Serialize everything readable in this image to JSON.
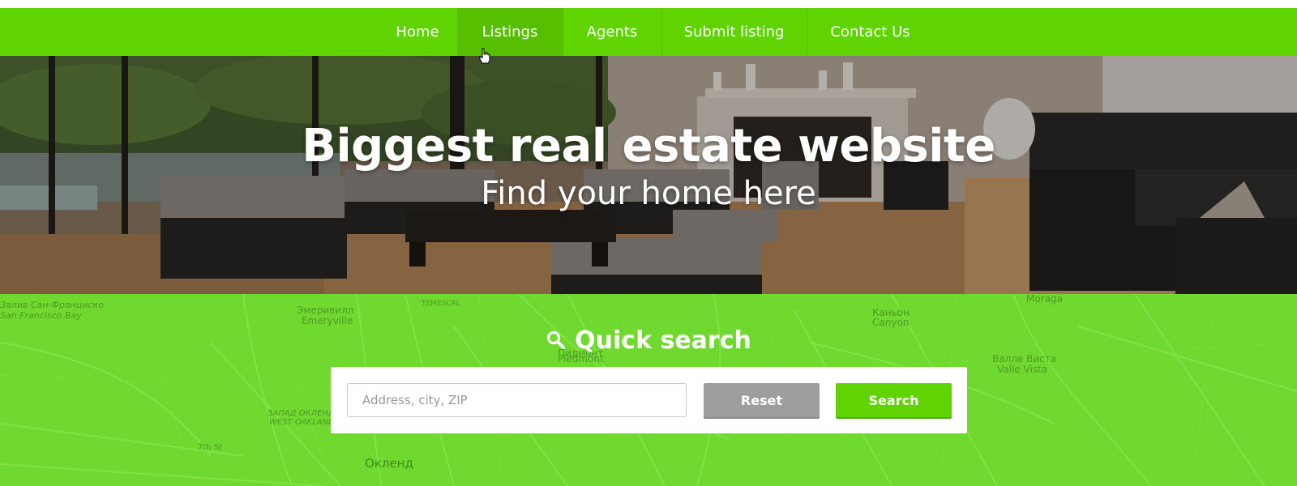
{
  "nav": {
    "items": [
      {
        "label": "Home"
      },
      {
        "label": "Listings"
      },
      {
        "label": "Agents"
      },
      {
        "label": "Submit listing"
      },
      {
        "label": "Contact Us"
      }
    ],
    "active_index": 1
  },
  "hero": {
    "title": "Biggest real estate website",
    "subtitle": "Find your home here"
  },
  "quick_search": {
    "title": "Quick search",
    "input_placeholder": "Address, city, ZIP",
    "reset_label": "Reset",
    "search_label": "Search"
  },
  "map_labels": {
    "sf_bay_ru": "Залив Сан-Франциско",
    "sf_bay_en": "San Francisco Bay",
    "emeryville_ru": "Эмеривилл",
    "emeryville_en": "Emeryville",
    "temescal": "TEMESCAL",
    "piedmont_ru": "Пидмонт",
    "piedmont_en": "Piedmont",
    "canyon_ru": "Каньон",
    "canyon_en": "Canyon",
    "moraga": "Moraga",
    "valle_vista_ru": "Валле Виста",
    "valle_vista_en": "Valle Vista",
    "west_oakland_ru": "ЗАПАД ОКЛЕНД",
    "west_oakland_en": "WEST OAKLAND",
    "oakland_ru": "Окленд",
    "street_7th": "7th St"
  },
  "colors": {
    "nav_green": "#5fd400",
    "nav_active": "#55bf00",
    "map_green": "#70d930",
    "reset_gray": "#9e9e9e"
  },
  "icons": {
    "quick_search_icon": "search-icon",
    "cursor": "hand-cursor-icon"
  }
}
